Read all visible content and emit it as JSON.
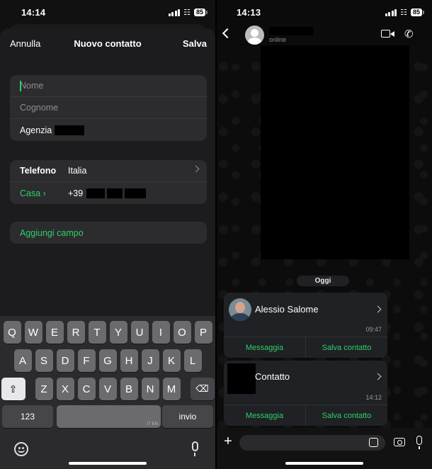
{
  "left_screen": {
    "status": {
      "time": "14:14",
      "battery": "85"
    },
    "nav": {
      "cancel": "Annulla",
      "title": "Nuovo contatto",
      "save": "Salva"
    },
    "name_group": {
      "first_name_placeholder": "Nome",
      "last_name_placeholder": "Cognome",
      "company_label": "Agenzia"
    },
    "phone_group": {
      "label": "Telefono",
      "country": "Italia",
      "type": "Casa",
      "prefix": "+39"
    },
    "add_field": "Aggiungi campo",
    "keyboard": {
      "row1": [
        "Q",
        "W",
        "E",
        "R",
        "T",
        "Y",
        "U",
        "I",
        "O",
        "P"
      ],
      "row2": [
        "A",
        "S",
        "D",
        "F",
        "G",
        "H",
        "J",
        "K",
        "L"
      ],
      "row3": [
        "Z",
        "X",
        "C",
        "V",
        "B",
        "N",
        "M"
      ],
      "numbers_key": "123",
      "space_hint": "IT EN",
      "return_key": "invio"
    }
  },
  "right_screen": {
    "status": {
      "time": "14:13",
      "battery": "85"
    },
    "header": {
      "status": "online"
    },
    "day_label": "Oggi",
    "cards": [
      {
        "name": "Alessio Salome",
        "time": "09:47",
        "message_action": "Messaggia",
        "save_action": "Salva contatto"
      },
      {
        "name": "Contatto",
        "time": "14:12",
        "message_action": "Messaggia",
        "save_action": "Salva contatto"
      }
    ]
  },
  "colors": {
    "accent_green": "#2fcf6a",
    "sheet_bg": "#1c1c1e",
    "group_bg": "#2c2c2e",
    "card_bg": "#1f2124"
  }
}
